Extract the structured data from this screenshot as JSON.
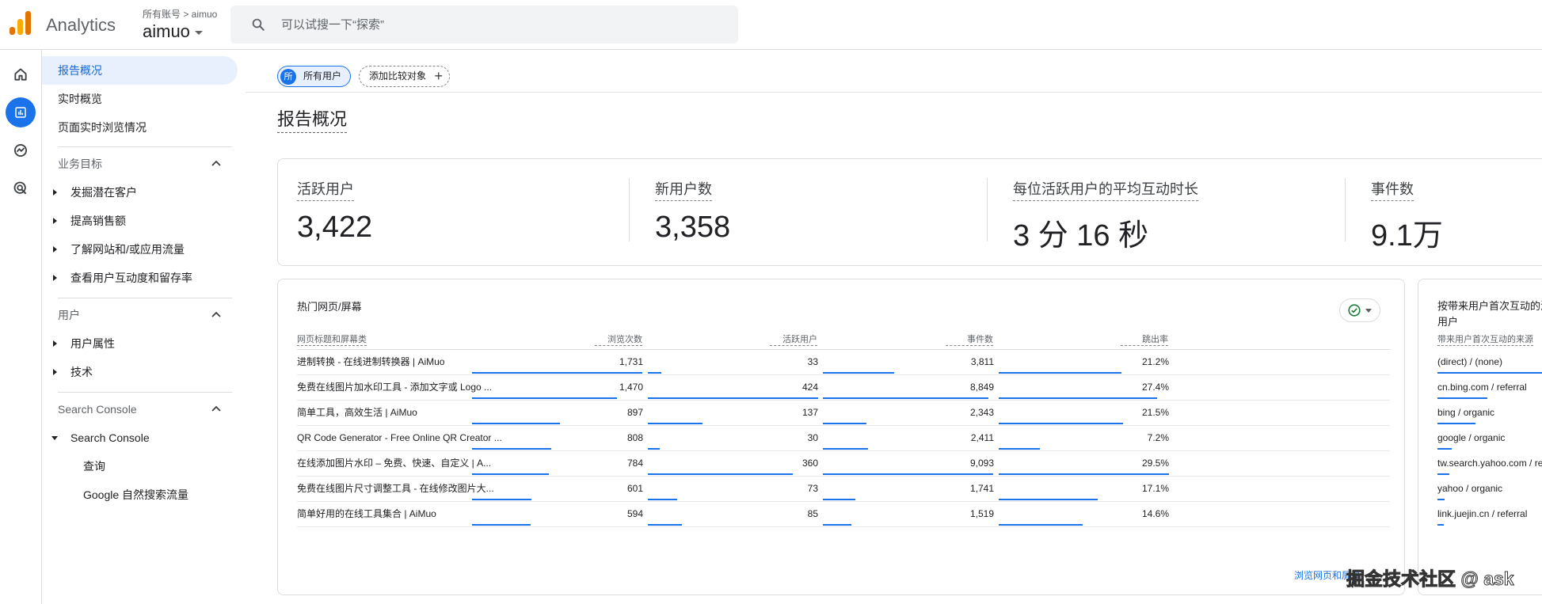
{
  "app": {
    "title": "Analytics"
  },
  "account": {
    "crumb": "所有账号 > aimuo",
    "name": "aimuo"
  },
  "search": {
    "placeholder": "可以试搜一下“探索”"
  },
  "nav": {
    "top_items": [
      "报告概况",
      "实时概览",
      "页面实时浏览情况"
    ],
    "business_section": "业务目标",
    "business_items": [
      "发掘潜在客户",
      "提高销售额",
      "了解网站和/或应用流量",
      "查看用户互动度和留存率"
    ],
    "user_section": "用户",
    "user_items": [
      "用户属性",
      "技术"
    ],
    "sc_section": "Search Console",
    "sc_group": "Search Console",
    "sc_items": [
      "查询",
      "Google 自然搜索流量"
    ]
  },
  "chips": {
    "all_users": "所有用户",
    "all_users_avatar": "所",
    "add_compare": "添加比较对象"
  },
  "page_title": "报告概况",
  "kpis": [
    {
      "label": "活跃用户",
      "value": "3,422"
    },
    {
      "label": "新用户数",
      "value": "3,358"
    },
    {
      "label": "每位活跃用户的平均互动时长",
      "value": "3 分 16 秒"
    },
    {
      "label": "事件数",
      "value": "9.1万"
    }
  ],
  "top_pages": {
    "title": "热门网页/屏幕",
    "columns": [
      "网页标题和屏幕类",
      "浏览次数",
      "活跃用户",
      "事件数",
      "跳出率"
    ],
    "rows": [
      {
        "title": "进制转换 - 在线进制转换器 | AiMuo",
        "views": "1,731",
        "users": "33",
        "events": "3,811",
        "bounce": "21.2%",
        "v": 1731,
        "u": 33,
        "e": 3811,
        "b": 21.2
      },
      {
        "title": "免费在线图片加水印工具 - 添加文字或 Logo ...",
        "views": "1,470",
        "users": "424",
        "events": "8,849",
        "bounce": "27.4%",
        "v": 1470,
        "u": 424,
        "e": 8849,
        "b": 27.4
      },
      {
        "title": "简单工具，高效生活 | AiMuo",
        "views": "897",
        "users": "137",
        "events": "2,343",
        "bounce": "21.5%",
        "v": 897,
        "u": 137,
        "e": 2343,
        "b": 21.5
      },
      {
        "title": "QR Code Generator - Free Online QR Creator ...",
        "views": "808",
        "users": "30",
        "events": "2,411",
        "bounce": "7.2%",
        "v": 808,
        "u": 30,
        "e": 2411,
        "b": 7.2
      },
      {
        "title": "在线添加图片水印 – 免费、快速、自定义 | A...",
        "views": "784",
        "users": "360",
        "events": "9,093",
        "bounce": "29.5%",
        "v": 784,
        "u": 360,
        "e": 9093,
        "b": 29.5
      },
      {
        "title": "免费在线图片尺寸调整工具 - 在线修改图片大...",
        "views": "601",
        "users": "73",
        "events": "1,741",
        "bounce": "17.1%",
        "v": 601,
        "u": 73,
        "e": 1741,
        "b": 17.1
      },
      {
        "title": "简单好用的在线工具集合 | AiMuo",
        "views": "594",
        "users": "85",
        "events": "1,519",
        "bounce": "14.6%",
        "v": 594,
        "u": 85,
        "e": 1519,
        "b": 14.6
      }
    ],
    "link": "浏览网页和屏幕"
  },
  "sources": {
    "title": "按带来用户首次互动的活跃用户",
    "column": "带来用户首次互动的来源",
    "rows": [
      {
        "name": "(direct) / (none)",
        "f": 1.0
      },
      {
        "name": "cn.bing.com / referral",
        "f": 0.42
      },
      {
        "name": "bing / organic",
        "f": 0.32
      },
      {
        "name": "google / organic",
        "f": 0.12
      },
      {
        "name": "tw.search.yahoo.com / referral",
        "f": 0.1
      },
      {
        "name": "yahoo / organic",
        "f": 0.06
      },
      {
        "name": "link.juejin.cn / referral",
        "f": 0.05
      }
    ]
  },
  "watermark": "掘金技术社区 @ ask",
  "colors": {
    "accent": "#1a73e8",
    "active_bg": "#e8f0fe",
    "logo_orange": "#e37400",
    "logo_yellow": "#f9ab00"
  }
}
